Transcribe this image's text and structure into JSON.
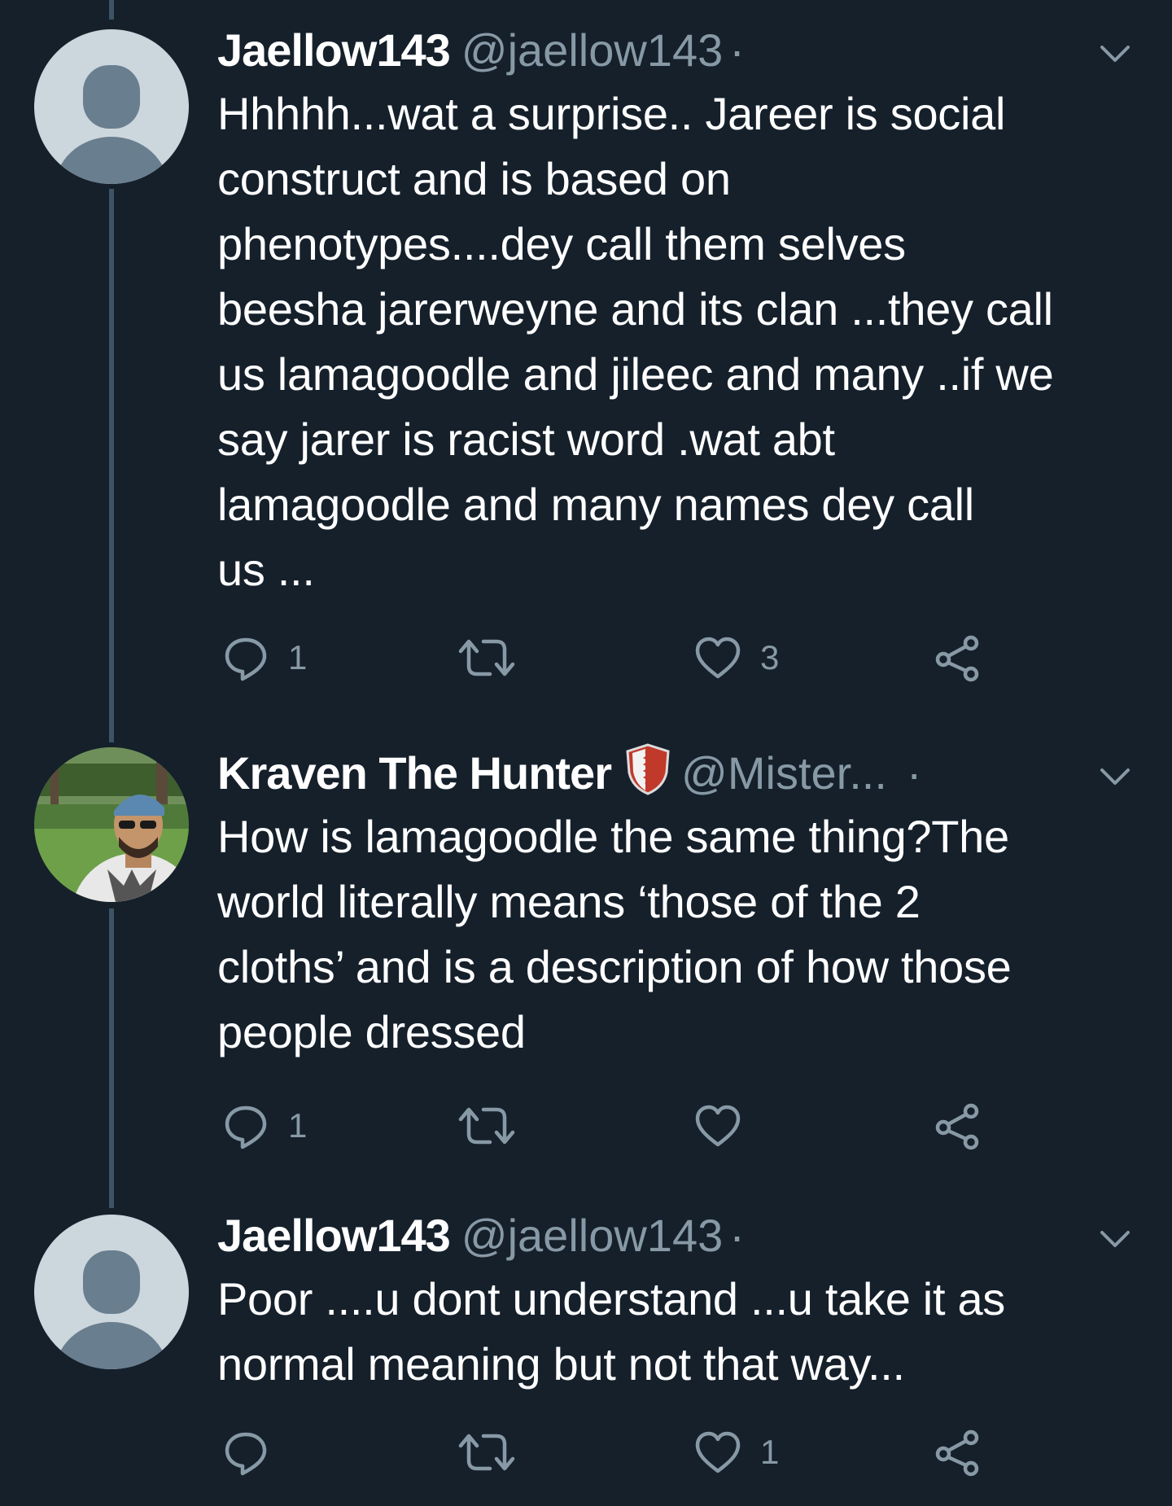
{
  "colors": {
    "background": "#15202b",
    "text": "#ffffff",
    "secondary": "#8899a6",
    "thread_line": "#3d5466",
    "avatar_placeholder_bg": "#ccd6dd",
    "avatar_placeholder_fg": "#697e8f"
  },
  "tweets": [
    {
      "name": "Jaellow143",
      "handle": "@jaellow143",
      "separator": "·",
      "avatar": "default-avatar",
      "text": "Hhhhh...wat a surprise.. Jareer is social\nconstruct and is based on\nphenotypes....dey  call  them selves\nbeesha jarerweyne and its clan ...they call\nus lamagoodle and jileec and many ..if we\nsay jarer is racist word  .wat abt\nlamagoodle and many names dey call\nus ...",
      "reply_count": "1",
      "retweet_count": "",
      "like_count": "3"
    },
    {
      "name": "Kraven The Hunter",
      "handle": "@Mister...",
      "separator": "·",
      "avatar": "photo-avatar",
      "badge": "shield-emoji",
      "text": "How is lamagoodle the same thing?The\nworld literally means ‘those of the 2\ncloths’ and is a description of how those\npeople dressed",
      "reply_count": "1",
      "retweet_count": "",
      "like_count": ""
    },
    {
      "name": "Jaellow143",
      "handle": "@jaellow143",
      "separator": "·",
      "avatar": "default-avatar",
      "text": "Poor ....u dont understand ...u take it as\nnormal meaning but not that way...",
      "reply_count": "",
      "retweet_count": "",
      "like_count": "1"
    }
  ]
}
